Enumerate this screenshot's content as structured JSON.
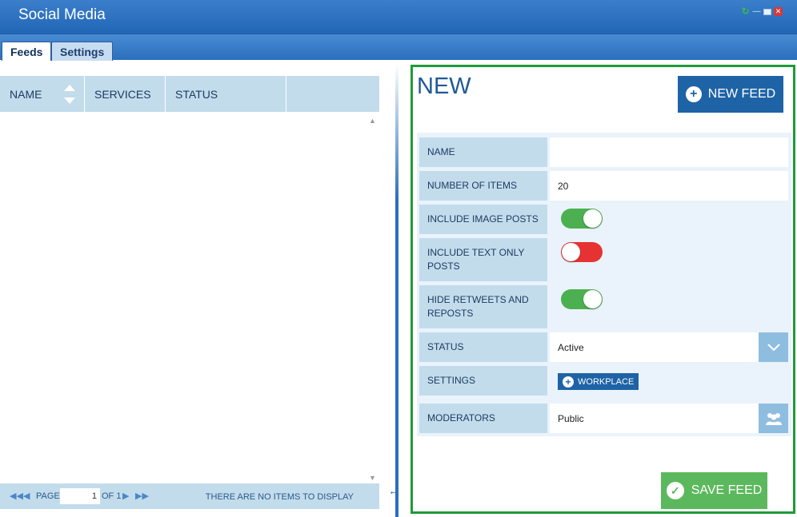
{
  "window": {
    "title": "Social Media",
    "controls": {
      "refresh": "↻",
      "minimize": "—",
      "close": "✕"
    }
  },
  "tabs": [
    {
      "label": "Feeds",
      "active": true
    },
    {
      "label": "Settings",
      "active": false
    }
  ],
  "grid": {
    "columns": [
      "NAME",
      "SERVICES",
      "STATUS"
    ],
    "rows": []
  },
  "pager": {
    "page_label": "PAGE",
    "page_value": "1",
    "of_label": "OF 1",
    "message": "THERE ARE NO ITEMS TO DISPLAY"
  },
  "panel": {
    "title": "NEW",
    "new_feed_label": "NEW FEED",
    "save_label": "SAVE FEED",
    "fields": {
      "name": {
        "label": "NAME",
        "value": ""
      },
      "number_of_items": {
        "label": "NUMBER OF ITEMS",
        "value": "20"
      },
      "include_image_posts": {
        "label": "INCLUDE IMAGE POSTS",
        "on": true
      },
      "include_text_only_posts": {
        "label": "INCLUDE TEXT ONLY POSTS",
        "on": false
      },
      "hide_retweets": {
        "label": "HIDE RETWEETS AND REPOSTS",
        "on": true
      },
      "status": {
        "label": "STATUS",
        "value": "Active"
      },
      "settings": {
        "label": "SETTINGS",
        "button_label": "WORKPLACE"
      },
      "moderators": {
        "label": "MODERATORS",
        "value": "Public"
      }
    }
  },
  "colors": {
    "accent": "#1e63a6",
    "header_blue": "#2a6fbd",
    "label_bg": "#c2dcec",
    "panel_border": "#1f9b3a",
    "toggle_on": "#4cb050",
    "toggle_off": "#e63232",
    "save_green": "#5cb85c"
  }
}
